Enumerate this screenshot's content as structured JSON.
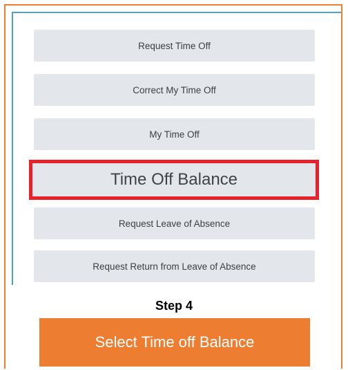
{
  "menu": {
    "items": [
      {
        "label": "Request Time Off"
      },
      {
        "label": "Correct My Time Off"
      },
      {
        "label": "My Time Off"
      },
      {
        "label": "Time Off Balance"
      },
      {
        "label": "Request Leave of Absence"
      },
      {
        "label": "Request Return from Leave of Absence"
      }
    ],
    "highlight_color": "#E8212B"
  },
  "instruction": {
    "step": "Step 4",
    "text": "Select Time off Balance",
    "accent_color": "#ED7D31"
  }
}
